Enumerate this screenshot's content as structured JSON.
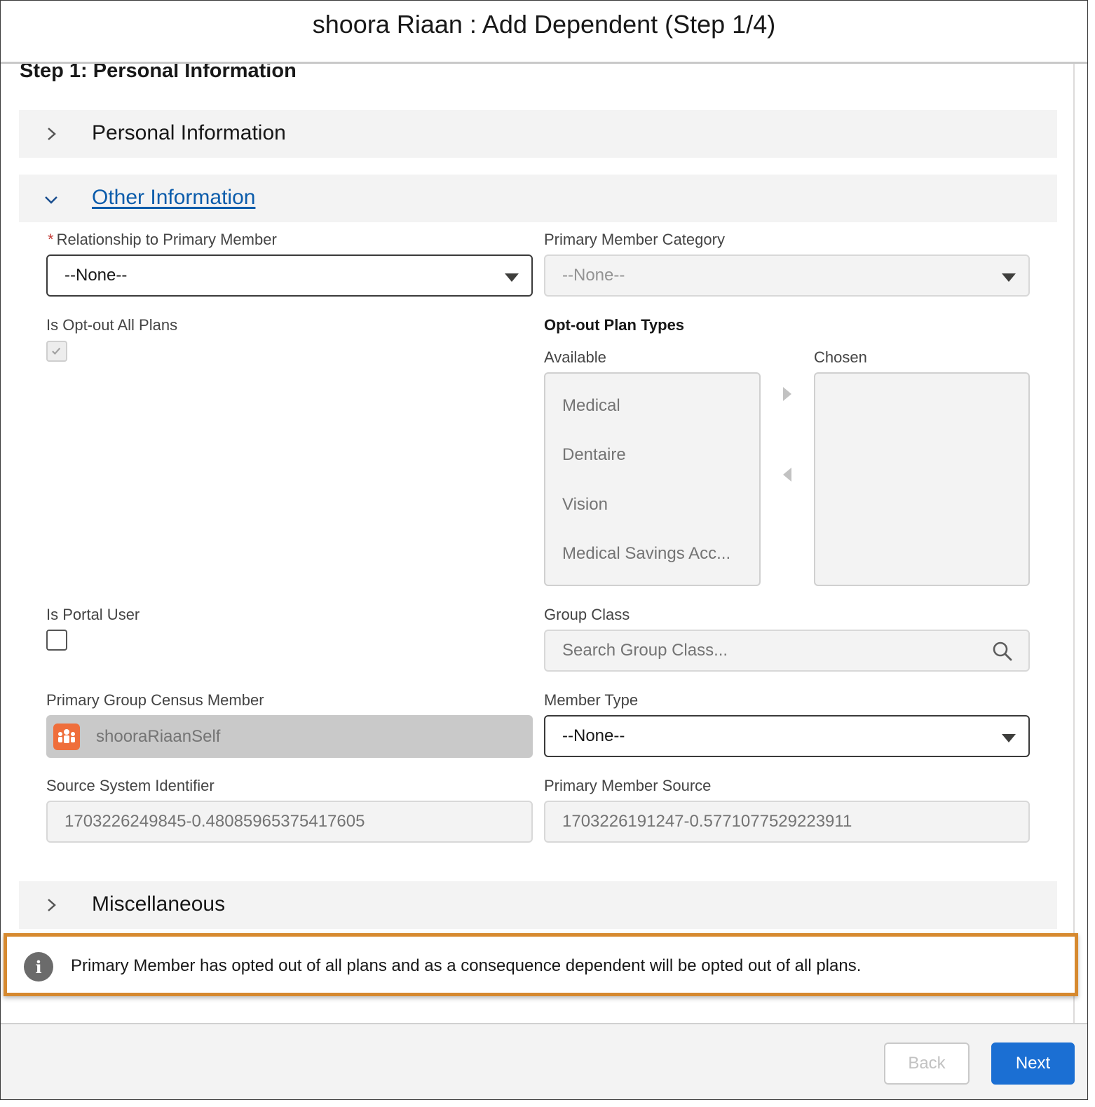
{
  "modal": {
    "title": "shoora Riaan : Add Dependent (Step 1/4)"
  },
  "step": {
    "title": "Step 1: Personal Information"
  },
  "sections": {
    "personal": {
      "label": "Personal Information",
      "expanded": false
    },
    "other": {
      "label": "Other Information",
      "expanded": true
    },
    "misc": {
      "label": "Miscellaneous",
      "expanded": false
    }
  },
  "form": {
    "relationship": {
      "required_mark": "*",
      "label": "Relationship to Primary Member",
      "value": "--None--"
    },
    "primary_member_category": {
      "label": "Primary Member Category",
      "value": "--None--"
    },
    "is_opt_out_all_plans": {
      "label": "Is Opt-out All Plans",
      "checked": true,
      "disabled": true
    },
    "opt_out_plan_types": {
      "label": "Opt-out Plan Types",
      "available_label": "Available",
      "chosen_label": "Chosen",
      "available": [
        "Medical",
        "Dentaire",
        "Vision",
        "Medical Savings Acc..."
      ],
      "chosen": []
    },
    "is_portal_user": {
      "label": "Is Portal User",
      "checked": false
    },
    "group_class": {
      "label": "Group Class",
      "placeholder": "Search Group Class..."
    },
    "primary_group_census_member": {
      "label": "Primary Group Census Member",
      "value": "shooraRiaanSelf"
    },
    "member_type": {
      "label": "Member Type",
      "value": "--None--"
    },
    "source_system_identifier": {
      "label": "Source System Identifier",
      "value": "1703226249845-0.48085965375417605"
    },
    "primary_member_source": {
      "label": "Primary Member Source",
      "value": "1703226191247-0.5771077529223911"
    }
  },
  "notice": {
    "text": "Primary Member has opted out of all plans and as a consequence dependent will be opted out of all plans."
  },
  "footer": {
    "back_label": "Back",
    "next_label": "Next"
  },
  "colors": {
    "accent_blue": "#1b6fd3",
    "link_blue": "#0b5cab",
    "highlight_orange": "#d6892f",
    "required_red": "#c23934",
    "census_icon": "#ef6e3b"
  },
  "icons": {
    "section_collapsed": "chevron-right-icon",
    "section_expanded": "chevron-down-icon",
    "search": "search-icon",
    "info": "info-icon",
    "census_member": "group-members-icon"
  }
}
